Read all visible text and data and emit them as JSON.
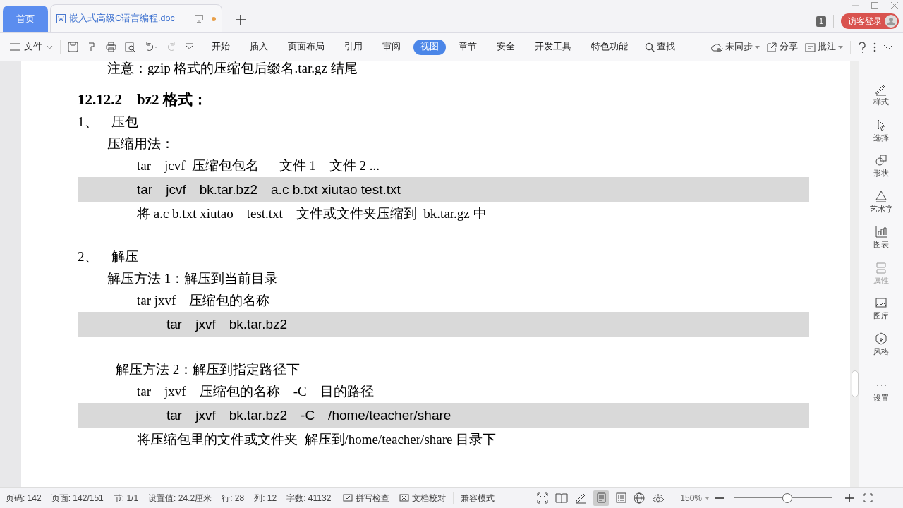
{
  "tabs": [
    {
      "label": "首页",
      "kind": "home",
      "selected": false
    },
    {
      "label": "嵌入式高级C语言编程.doc",
      "kind": "doc",
      "selected": true
    }
  ],
  "account": {
    "badge": "1",
    "login": "访客登录"
  },
  "toolbar": {
    "file_menu": "文件",
    "tabs": [
      {
        "label": "开始",
        "selected": false
      },
      {
        "label": "插入",
        "selected": false
      },
      {
        "label": "页面布局",
        "selected": false
      },
      {
        "label": "引用",
        "selected": false
      },
      {
        "label": "审阅",
        "selected": false
      },
      {
        "label": "视图",
        "selected": true
      },
      {
        "label": "章节",
        "selected": false
      },
      {
        "label": "安全",
        "selected": false
      },
      {
        "label": "开发工具",
        "selected": false
      },
      {
        "label": "特色功能",
        "selected": false
      }
    ],
    "search": "查找",
    "sync": "未同步",
    "share": "分享",
    "comment": "批注"
  },
  "document": [
    {
      "kind": "note",
      "text": "注意：gzip 格式的压缩包后缀名.tar.gz 结尾"
    },
    {
      "kind": "heading",
      "text": "12.12.2　bz2 格式："
    },
    {
      "kind": "item",
      "text": "1、　压包"
    },
    {
      "kind": "label",
      "text": "压缩用法："
    },
    {
      "kind": "command",
      "text": "tar　jcvf  压缩包包名　  文件 1　文件 2 ..."
    },
    {
      "kind": "code",
      "text": "tar　jcvf　bk.tar.bz2　a.c b.txt xiutao test.txt"
    },
    {
      "kind": "command",
      "text": "将 a.c b.txt xiutao　test.txt　文件或文件夹压缩到  bk.tar.gz 中"
    },
    {
      "kind": "item",
      "gap_before": true,
      "text": "2、　解压"
    },
    {
      "kind": "label",
      "text": "解压方法 1：解压到当前目录"
    },
    {
      "kind": "command",
      "text": "tar jxvf　压缩包的名称"
    },
    {
      "kind": "code-indented",
      "text": "tar　jxvf　bk.tar.bz2"
    },
    {
      "kind": "label-offset",
      "gap_before": true,
      "text": "解压方法 2：解压到指定路径下"
    },
    {
      "kind": "command",
      "text": "tar　jxvf　压缩包的名称　-C　目的路径"
    },
    {
      "kind": "code-indented",
      "text": "tar　jxvf　bk.tar.bz2　-C　/home/teacher/share"
    },
    {
      "kind": "command",
      "text": "将压缩包里的文件或文件夹  解压到/home/teacher/share 目录下"
    }
  ],
  "side_panel": [
    {
      "label": "样式",
      "disabled": false
    },
    {
      "label": "选择",
      "disabled": false
    },
    {
      "label": "形状",
      "disabled": false
    },
    {
      "label": "艺术字",
      "disabled": false
    },
    {
      "label": "图表",
      "disabled": false
    },
    {
      "label": "属性",
      "disabled": true
    },
    {
      "label": "图库",
      "disabled": false
    },
    {
      "label": "风格",
      "disabled": false
    },
    {
      "label": "设置",
      "disabled": false
    }
  ],
  "status_bar": {
    "items": [
      "页码: 142",
      "页面: 142/151",
      "节: 1/1",
      "设置值: 24.2厘米",
      "行: 28",
      "列: 12",
      "字数: 41132"
    ],
    "spell": "拼写检查",
    "proof": "文档校对",
    "compat": "兼容模式",
    "zoom": "150%",
    "zoom_slider": {
      "level": 0.55
    }
  }
}
